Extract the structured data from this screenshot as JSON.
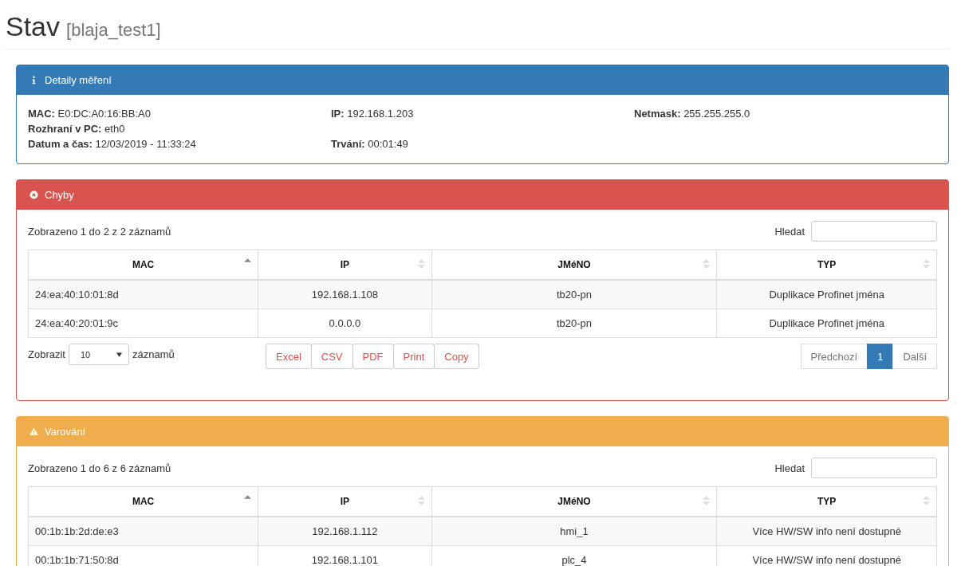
{
  "page": {
    "title": "Stav",
    "subtitle": "[blaja_test1]"
  },
  "panels": [
    {
      "kind": "info",
      "title": "Detaily měření",
      "detail_rows": [
        [
          {
            "label": "MAC:",
            "value": "E0:DC:A0:16:BB:A0"
          },
          {
            "label": "IP:",
            "value": "192.168.1.203"
          },
          {
            "label": "Netmask:",
            "value": "255.255.255.0"
          }
        ],
        [
          {
            "label": "Rozhraní v PC:",
            "value": "eth0"
          },
          null,
          null
        ],
        [
          {
            "label": "Datum a čas:",
            "value": "12/03/2019 - 11:33:24"
          },
          {
            "label": "Trvání:",
            "value": "00:01:49"
          },
          null
        ]
      ]
    },
    {
      "kind": "danger",
      "title": "Chyby",
      "info": "Zobrazeno 1 do 2 z 2 záznamů",
      "search_label": "Hledat",
      "columns": [
        {
          "label": "MAC",
          "sorted": true
        },
        {
          "label": "IP",
          "sorted": false
        },
        {
          "label": "JMéNO",
          "sorted": false
        },
        {
          "label": "TYP",
          "sorted": false
        }
      ],
      "rows": [
        [
          "24:ea:40:10:01:8d",
          "192.168.1.108",
          "tb20-pn",
          "Duplikace Profinet jména"
        ],
        [
          "24:ea:40:20:01:9c",
          "0.0.0.0",
          "tb20-pn",
          "Duplikace Profinet jména"
        ]
      ],
      "length": {
        "before": "Zobrazit",
        "value": "10",
        "after": "záznamů"
      },
      "export_buttons": [
        "Excel",
        "CSV",
        "PDF",
        "Print",
        "Copy"
      ],
      "pagination": [
        {
          "label": "Předchozí",
          "selected": false
        },
        {
          "label": "1",
          "selected": true
        },
        {
          "label": "Další",
          "selected": false
        }
      ]
    },
    {
      "kind": "warning",
      "title": "Varování",
      "info": "Zobrazeno 1 do 6 z 6 záznamů",
      "search_label": "Hledat",
      "columns": [
        {
          "label": "MAC",
          "sorted": true
        },
        {
          "label": "IP",
          "sorted": false
        },
        {
          "label": "JMéNO",
          "sorted": false
        },
        {
          "label": "TYP",
          "sorted": false
        }
      ],
      "rows": [
        [
          "00:1b:1b:2d:de:e3",
          "192.168.1.112",
          "hmi_1",
          "Více HW/SW info není dostupné"
        ],
        [
          "00:1b:1b:71:50:8d",
          "192.168.1.101",
          "plc_4",
          "Více HW/SW info není dostupné"
        ]
      ]
    }
  ]
}
